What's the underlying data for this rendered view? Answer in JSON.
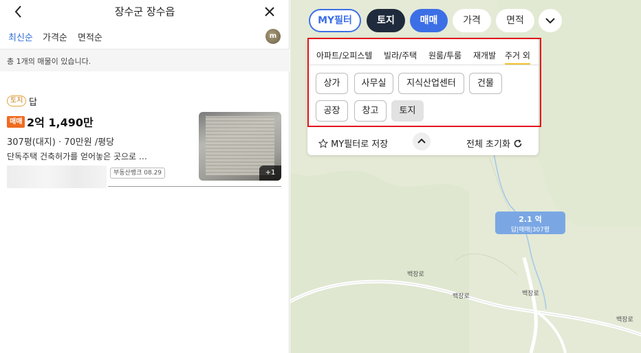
{
  "header": {
    "title": "장수군 장수읍"
  },
  "sort_tabs": [
    {
      "label": "최신순"
    },
    {
      "label": "가격순"
    },
    {
      "label": "면적순"
    }
  ],
  "count_text": "총 1개의 매물이 있습니다.",
  "listing": {
    "category_badge": "토지",
    "land_type": "답",
    "deal_badge": "매매",
    "price": "2억 1,490만",
    "area_info": "307평(대지) · 70만원 /평당",
    "description": "단독주택 건축허가를 얻어놓은 곳으로 …",
    "source_tag": "부동산뱅크 08.29",
    "photo_count": "+1"
  },
  "filters": {
    "myfilter_label": "MY필터",
    "land_label": "토지",
    "sale_label": "매매",
    "price_label": "가격",
    "area_label": "면적"
  },
  "category_tabs": [
    {
      "label": "아파트/오피스텔"
    },
    {
      "label": "빌라/주택"
    },
    {
      "label": "원룸/투룸"
    },
    {
      "label": "재개발"
    },
    {
      "label": "주거 외"
    }
  ],
  "sub_categories": [
    {
      "label": "상가"
    },
    {
      "label": "사무실"
    },
    {
      "label": "지식산업센터"
    },
    {
      "label": "건물"
    },
    {
      "label": "공장"
    },
    {
      "label": "창고"
    },
    {
      "label": "토지"
    }
  ],
  "panel_footer": {
    "save_label": "MY필터로 저장",
    "reset_label": "전체 초기화"
  },
  "map_marker": {
    "price": "2.1 억",
    "info": "답|매매|307평"
  },
  "road_labels": [
    "백장로",
    "백장로",
    "백장로",
    "백장로"
  ],
  "colors": {
    "accent_blue": "#3c6fe6",
    "dark_navy": "#1f2a3c",
    "sale_orange": "#ef6b1f",
    "highlight_red": "#e2141a",
    "map_bg": "#e4ead6"
  }
}
